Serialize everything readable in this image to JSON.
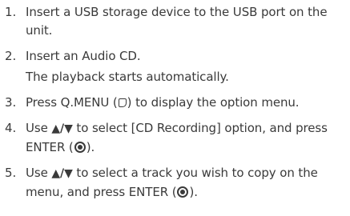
{
  "steps": [
    {
      "num": "1.",
      "text": "Insert a USB storage device to the USB port on the unit."
    },
    {
      "num": "2.",
      "text": "Insert an Audio CD.",
      "sub": "The playback starts automatically."
    },
    {
      "num": "3.",
      "pre": "Press Q.MENU (",
      "post": ") to display the option menu.",
      "icon": "q-menu-icon"
    },
    {
      "num": "4.",
      "pre": "Use ",
      "arrows": "▲/▼",
      "mid": " to select [CD Recording] option, and press ENTER (",
      "post": ").",
      "icon": "enter-icon"
    },
    {
      "num": "5.",
      "pre": "Use ",
      "arrows": "▲/▼",
      "mid": " to select a track you wish to copy on the menu, and press ENTER (",
      "post": ").",
      "icon": "enter-icon"
    }
  ]
}
